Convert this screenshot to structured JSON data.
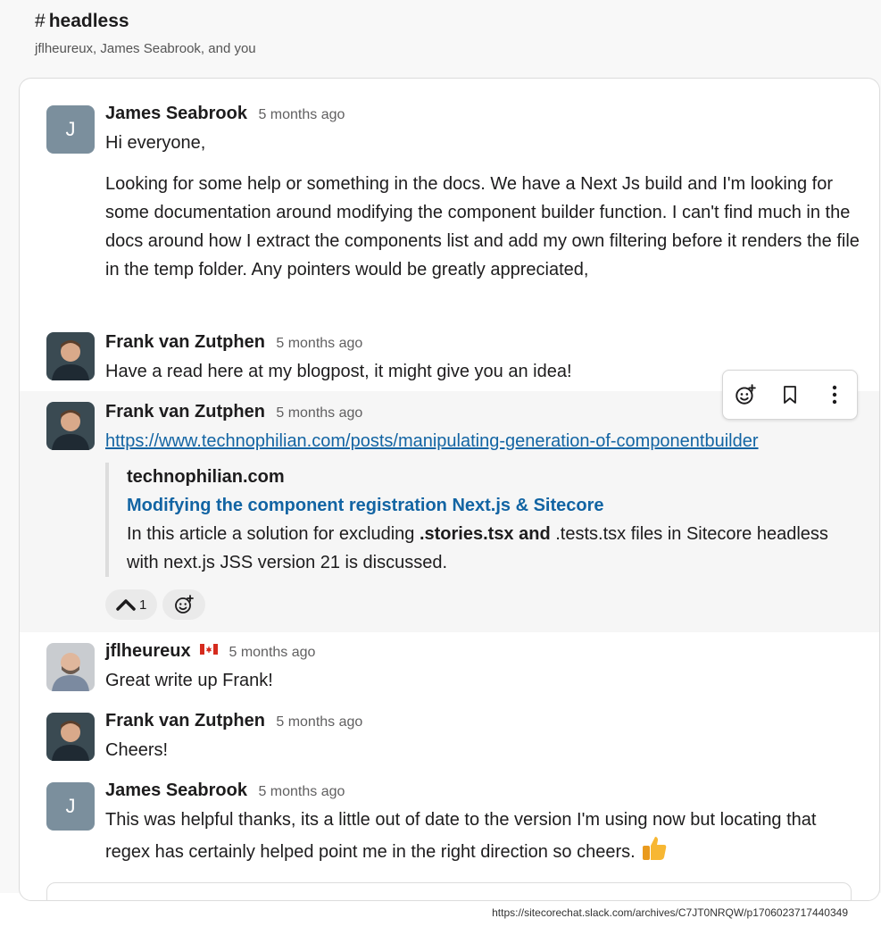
{
  "channel": {
    "name": "headless",
    "hash": "#",
    "participants": "jflheureux, James Seabrook, and you"
  },
  "messages": [
    {
      "author": "James Seabrook",
      "avatar_letter": "J",
      "time": "5 months ago",
      "paragraphs": [
        "Hi everyone,",
        "Looking for some help or something in the docs. We have a Next Js build and I'm looking for some documentation around modifying the component builder function. I can't find much in the docs around how I extract the components list and add my own filtering before it renders the file in the temp folder. Any pointers would be greatly appreciated,"
      ]
    },
    {
      "author": "Frank van Zutphen",
      "time": "5 months ago",
      "text": "Have a read here at my blogpost, it might give you an idea!"
    },
    {
      "author": "Frank van Zutphen",
      "time": "5 months ago",
      "link": "https://www.technophilian.com/posts/manipulating-generation-of-componentbuilder",
      "unfurl": {
        "site": "technophilian.com",
        "title": "Modifying the component registration Next.js & Sitecore",
        "desc_before": "In this article a solution for excluding ",
        "desc_bold": ".stories.tsx and",
        "desc_after": " .tests.tsx files in Sitecore headless with next.js JSS version 21 is discussed."
      },
      "reaction": {
        "icon": "caret-up-icon",
        "count": "1"
      }
    },
    {
      "author": "jflheureux",
      "time": "5 months ago",
      "flag": "canada-flag",
      "text": "Great write up Frank!"
    },
    {
      "author": "Frank van Zutphen",
      "time": "5 months ago",
      "text": "Cheers!"
    },
    {
      "author": "James Seabrook",
      "avatar_letter": "J",
      "time": "5 months ago",
      "text": "This was helpful thanks, its a little out of date to the version I'm using now but locating that regex has certainly helped point me in the right direction so cheers.",
      "emoji": "thumbs-up"
    }
  ],
  "toolbar": {
    "icons": [
      "add-reaction-icon",
      "bookmark-icon",
      "more-actions-icon"
    ]
  },
  "footer": {
    "url": "https://sitecorechat.slack.com/archives/C7JT0NRQW/p1706023717440349"
  },
  "colors": {
    "link": "#1264a3",
    "avatar_letter_bg": "#7b8f9d",
    "hover_bg": "#f6f6f6"
  }
}
